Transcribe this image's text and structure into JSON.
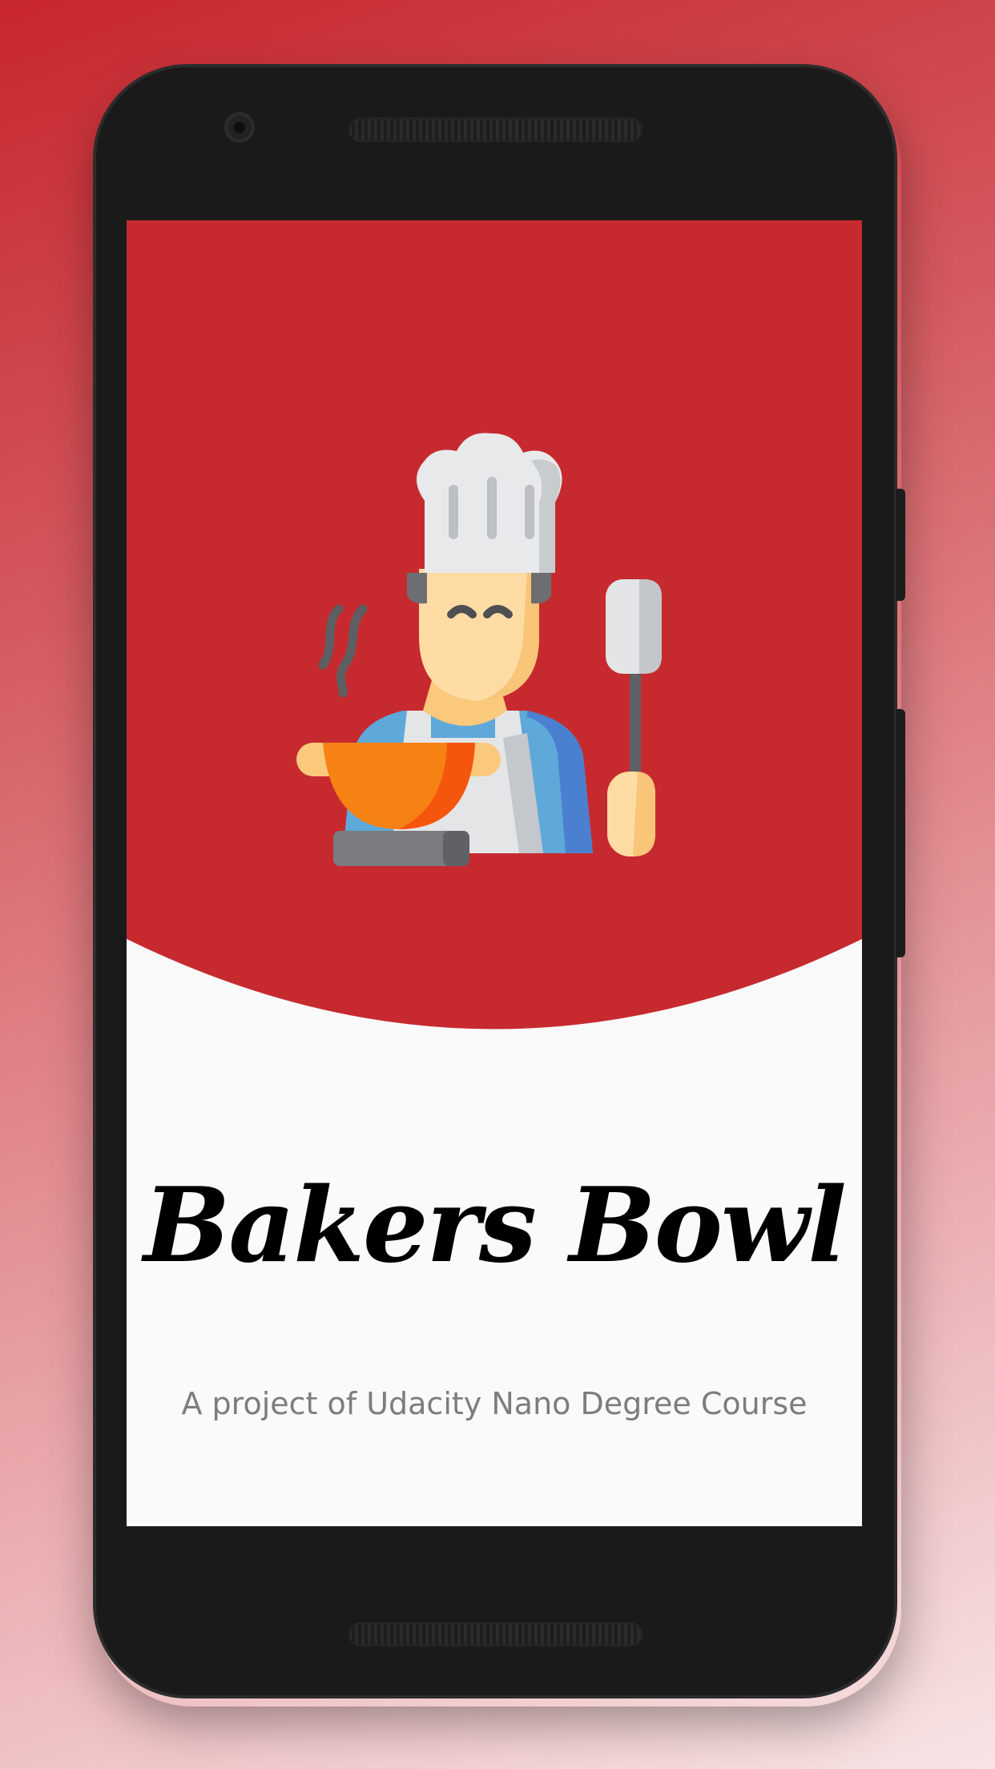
{
  "splash": {
    "app_name": "Bakers Bowl",
    "subtitle": "A project of Udacity Nano Degree Course"
  },
  "illustration": {
    "icon": "chef-cooking-icon"
  },
  "colors": {
    "primary_red": "#c62a2f",
    "screen_background": "#fafafa",
    "title_text": "#000000",
    "subtitle_text": "#7d7d7d"
  }
}
